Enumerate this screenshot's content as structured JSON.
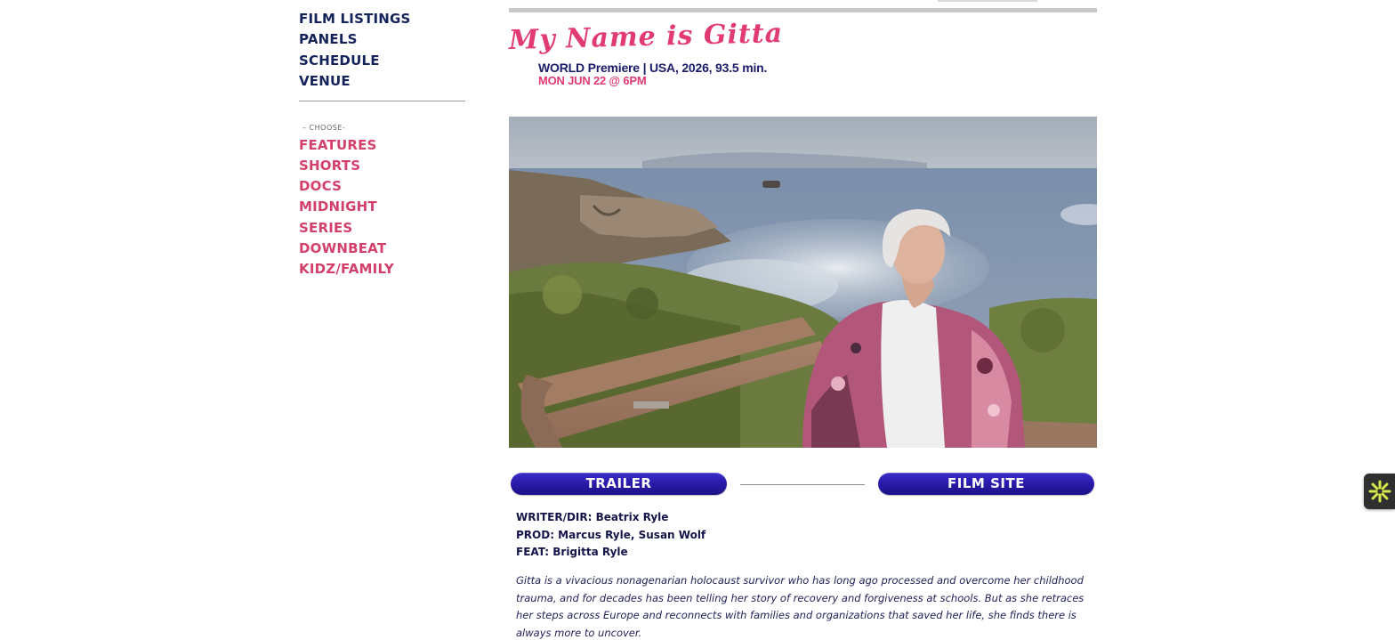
{
  "sidebar": {
    "main_nav": [
      "FILM LISTINGS",
      "PANELS",
      "SCHEDULE",
      "VENUE"
    ],
    "choose_label": "– CHOOSE-",
    "categories": [
      "FEATURES",
      "SHORTS",
      "DOCS",
      "MIDNIGHT",
      "SERIES",
      "DOWNBEAT",
      "KIDZ/FAMILY"
    ]
  },
  "film": {
    "title": "My Name is Gitta",
    "premiere_line": "WORLD Premiere | USA, 2026, 93.5 min.",
    "showtime": "MON JUN 22 @ 6PM"
  },
  "buttons": {
    "trailer": "TRAILER",
    "film_site": "FILM SITE"
  },
  "credits": [
    "WRITER/DIR: Beatrix Ryle",
    "PROD: Marcus Ryle, Susan Wolf",
    "FEAT: Brigitta Ryle"
  ],
  "synopsis": "Gitta is a vivacious nonagenarian holocaust survivor who has long ago processed and overcome her childhood trauma, and for decades has been telling her story of recovery and forgiveness at schools. But as she retraces her steps across Europe and reconnects with families and organizations that saved her life, she finds there is always more to uncover.",
  "colors": {
    "nav_primary": "#14235a",
    "nav_category": "#d2406b",
    "title_accent": "#e23a75",
    "button": "#2a1aa8",
    "widget_icon": "#d7e84a"
  },
  "icons": {
    "widget": "asterisk-burst-icon"
  }
}
